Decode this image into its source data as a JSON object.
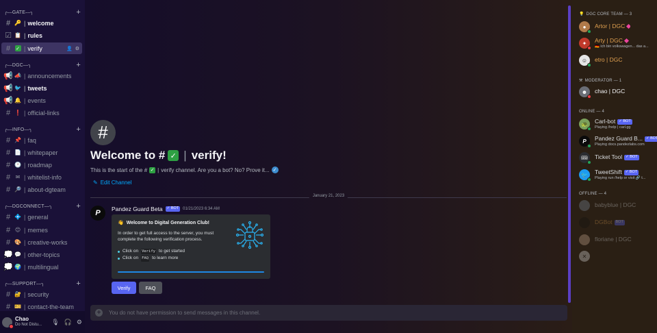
{
  "sidebar": {
    "categories": [
      {
        "label": "╭⎯⎯GATE⎯⎯╮"
      },
      {
        "label": "╭⎯⎯DGC⎯⎯╮"
      },
      {
        "label": "╭⎯⎯INFO⎯⎯╮"
      },
      {
        "label": "╭⎯⎯DGCONNECT⎯⎯╮"
      },
      {
        "label": "╭⎯⎯SUPPORT⎯⎯╮"
      }
    ],
    "channels": [
      {
        "emoji": "🔑",
        "name": "welcome"
      },
      {
        "emoji": "📋",
        "name": "rules"
      },
      {
        "emoji": "✅",
        "name": "verify"
      },
      {
        "emoji": "📣",
        "name": "announcements"
      },
      {
        "emoji": "🐦",
        "name": "tweets"
      },
      {
        "emoji": "🔔",
        "name": "events"
      },
      {
        "emoji": "❗",
        "name": "official-links"
      },
      {
        "emoji": "📌",
        "name": "faq"
      },
      {
        "emoji": "📄",
        "name": "whitepaper"
      },
      {
        "emoji": "🕐",
        "name": "roadmap"
      },
      {
        "emoji": "✉",
        "name": "whitelist-info"
      },
      {
        "emoji": "🔎",
        "name": "about-dgteam"
      },
      {
        "emoji": "💠",
        "name": "general"
      },
      {
        "emoji": "😊",
        "name": "memes"
      },
      {
        "emoji": "🎨",
        "name": "creative-works"
      },
      {
        "emoji": "💬",
        "name": "other-topics"
      },
      {
        "emoji": "🌍",
        "name": "multilingual"
      },
      {
        "emoji": "🔐",
        "name": "security"
      },
      {
        "emoji": "🎫",
        "name": "contact-the-team"
      }
    ]
  },
  "user": {
    "name": "Chao",
    "status": "Do Not Distu..."
  },
  "main": {
    "welcome_prefix": "Welcome to #",
    "welcome_channel": "verify!",
    "intro_prefix": "This is the start of the #",
    "intro_suffix": "verify channel. Are you a bot? No? Prove it...",
    "edit_channel": "Edit Channel",
    "date_divider": "January 21, 2023",
    "message": {
      "author": "Pandez Guard Beta",
      "bot_tag": "BOT",
      "timestamp": "01/21/2023 6:34 AM",
      "embed_title": "Welcome to Digital Generation Club!",
      "embed_emoji": "👋",
      "embed_desc": "In order to get full access to the server, you must complete the following verification process.",
      "step1_pre": "Click on",
      "step1_code": "Verify",
      "step1_post": "to get started",
      "step2_pre": "Click on",
      "step2_code": "FAQ",
      "step2_post": "to learn more",
      "verify_button": "Verify",
      "faq_button": "FAQ"
    },
    "composer_placeholder": "You do not have permission to send messages in this channel."
  },
  "members": {
    "roles": [
      {
        "label": "DGC CORE TEAM — 3"
      },
      {
        "label": "MODERATOR — 1"
      },
      {
        "label": "ONLINE — 4"
      },
      {
        "label": "OFFLINE — 4"
      }
    ],
    "list": [
      {
        "name": "Artor | DGC",
        "activity": ""
      },
      {
        "name": "Arty | DGC",
        "activity": "🇩🇪 ich bin volkswagen... das a..."
      },
      {
        "name": "etro | DGC",
        "activity": ""
      },
      {
        "name": "chao | DGC",
        "activity": ""
      },
      {
        "name": "Carl-bot",
        "activity": "Playing /help | carl.gg"
      },
      {
        "name": "Pandez Guard B...",
        "activity": "Playing docs.pandezlabs.com"
      },
      {
        "name": "Ticket Tool",
        "activity": ""
      },
      {
        "name": "TweetShift",
        "activity": "Playing run /help or visit 🔗 t..."
      },
      {
        "name": "babyblue | DGC",
        "activity": ""
      },
      {
        "name": "DGBot",
        "activity": ""
      },
      {
        "name": "floriane | DGC",
        "activity": ""
      },
      {
        "name": "",
        "activity": ""
      }
    ],
    "bot_tag": "BOT"
  },
  "colors": {
    "accent": "#5865f2",
    "sidebar_bg": "#1a1138",
    "members_bg": "#2a1f14",
    "core_team": "#e0a050"
  }
}
